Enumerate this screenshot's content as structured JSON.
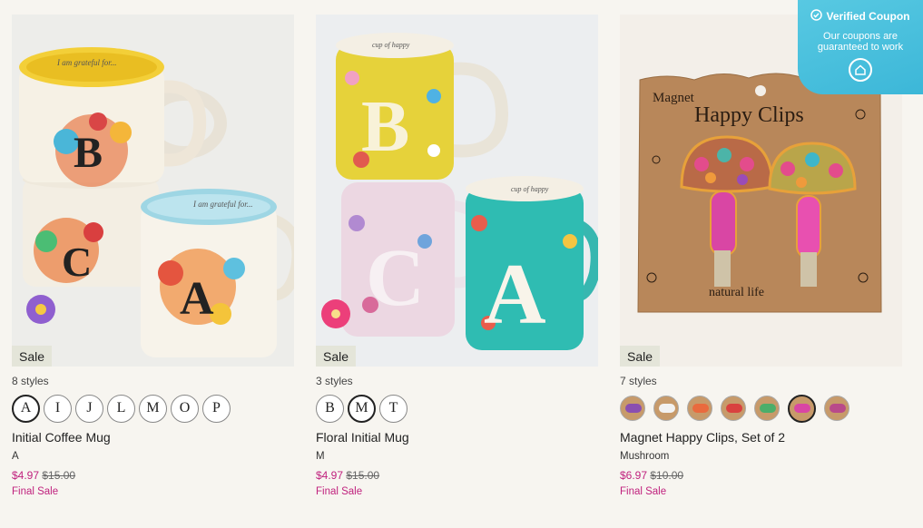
{
  "coupon": {
    "title": "Verified Coupon",
    "subtitle": "Our coupons are guaranteed to work",
    "icon": "shield-check-icon",
    "badge_icon": "home-icon"
  },
  "products": [
    {
      "sale": "Sale",
      "styles": "8 styles",
      "swatches": [
        "A",
        "I",
        "J",
        "L",
        "M",
        "O",
        "P"
      ],
      "selected_index": 0,
      "title": "Initial Coffee Mug",
      "variant": "A",
      "price": "$4.97",
      "was": "$15.00",
      "final": "Final Sale",
      "image_text": [
        "I am grateful for..."
      ]
    },
    {
      "sale": "Sale",
      "styles": "3 styles",
      "swatches": [
        "B",
        "M",
        "T"
      ],
      "selected_index": 1,
      "title": "Floral Initial Mug",
      "variant": "M",
      "price": "$4.97",
      "was": "$15.00",
      "final": "Final Sale",
      "image_text": [
        "cup of happy"
      ]
    },
    {
      "sale": "Sale",
      "styles": "7 styles",
      "swatch_count": 7,
      "selected_index": 5,
      "title": "Magnet Happy Clips, Set of 2",
      "variant": "Mushroom",
      "price": "$6.97",
      "was": "$10.00",
      "final": "Final Sale",
      "image_text": [
        "Magnet",
        "Happy Clips",
        "natural life"
      ]
    }
  ],
  "colors": {
    "sale_price": "#c0227e",
    "sale_badge_bg": "#e4e5d9",
    "coupon_bg": "#3cb7d8",
    "page_bg": "#f7f5f0"
  }
}
